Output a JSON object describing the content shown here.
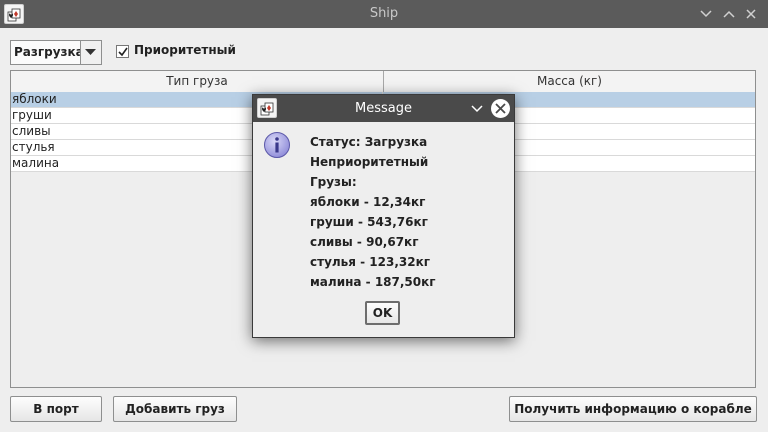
{
  "window": {
    "title": "Ship",
    "icon": "java-app-icon"
  },
  "toolbar": {
    "mode_select": {
      "value": "Разгрузка",
      "icon": "chevron-down-icon"
    },
    "priority_checkbox": {
      "label": "Приоритетный",
      "checked": true
    }
  },
  "table": {
    "columns": [
      "Тип груза",
      "Масса (кг)"
    ],
    "rows": [
      {
        "type": "яблоки",
        "mass": "",
        "selected": true
      },
      {
        "type": "груши",
        "mass": ""
      },
      {
        "type": "сливы",
        "mass": ""
      },
      {
        "type": "стулья",
        "mass": ""
      },
      {
        "type": "малина",
        "mass": ""
      }
    ]
  },
  "buttons": {
    "to_port": "В порт",
    "add_cargo": "Добавить груз",
    "get_info": "Получить информацию о корабле"
  },
  "dialog": {
    "title": "Message",
    "icon": "info-icon",
    "lines": [
      "Статус: Загрузка",
      "Неприоритетный",
      "Грузы:",
      "яблоки - 12,34кг",
      "груши - 543,76кг",
      "сливы - 90,67кг",
      "стулья - 123,32кг",
      "малина - 187,50кг"
    ],
    "ok_label": "OK"
  },
  "colors": {
    "titlebar": "#5b5b5b",
    "dialog_titlebar": "#4a4a4a",
    "selected_row": "#b8cfe5",
    "info_icon": "#8d8ad8"
  }
}
